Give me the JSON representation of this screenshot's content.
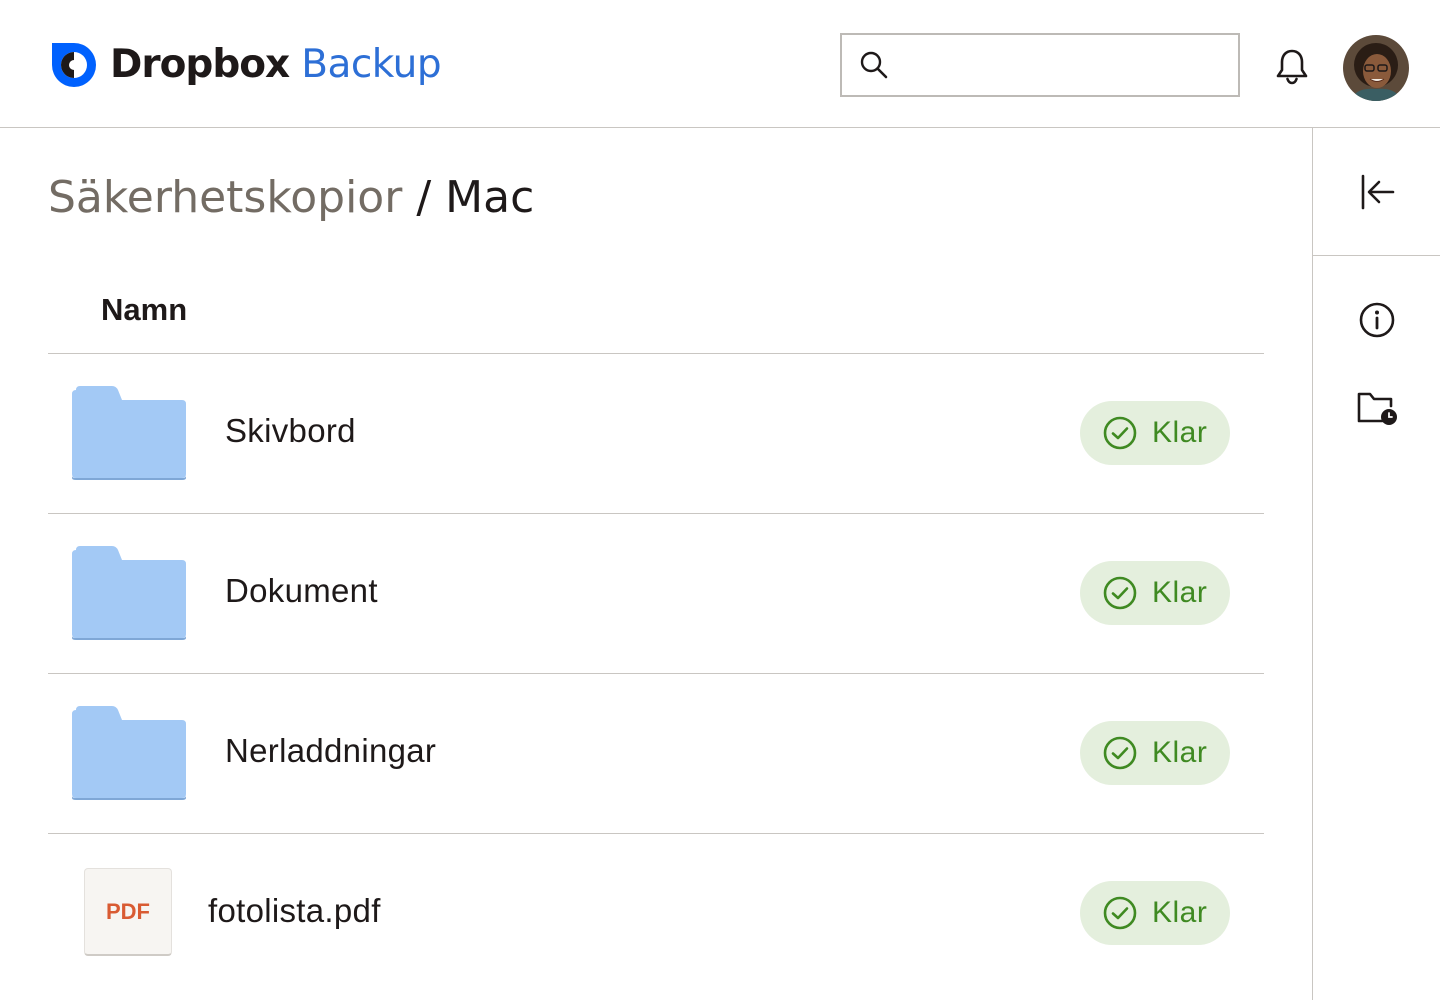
{
  "header": {
    "brand": "Dropbox",
    "product": "Backup",
    "search": {
      "value": "",
      "placeholder": ""
    }
  },
  "breadcrumb": {
    "parent": "Säkerhetskopior",
    "separator": "/",
    "current": "Mac"
  },
  "table": {
    "columns": [
      "Namn"
    ],
    "rows": [
      {
        "name": "Skivbord",
        "type": "folder",
        "status": "Klar"
      },
      {
        "name": "Dokument",
        "type": "folder",
        "status": "Klar"
      },
      {
        "name": "Nerladdningar",
        "type": "folder",
        "status": "Klar"
      },
      {
        "name": "fotolista.pdf",
        "type": "pdf",
        "file_badge": "PDF",
        "status": "Klar"
      }
    ]
  },
  "colors": {
    "brand_blue": "#0061fe",
    "product_blue": "#2d6fd6",
    "folder_blue": "#a3c9f5",
    "status_green": "#3f8a22",
    "status_bg": "#e4efdd",
    "pdf_red": "#d95b33"
  },
  "icons": {
    "logo": "dropbox-backup-logo-icon",
    "search": "search-icon",
    "notifications": "bell-icon",
    "collapse": "collapse-left-icon",
    "info": "info-icon",
    "folder_history": "folder-clock-icon",
    "status": "check-circle-icon",
    "folder": "folder-icon"
  }
}
